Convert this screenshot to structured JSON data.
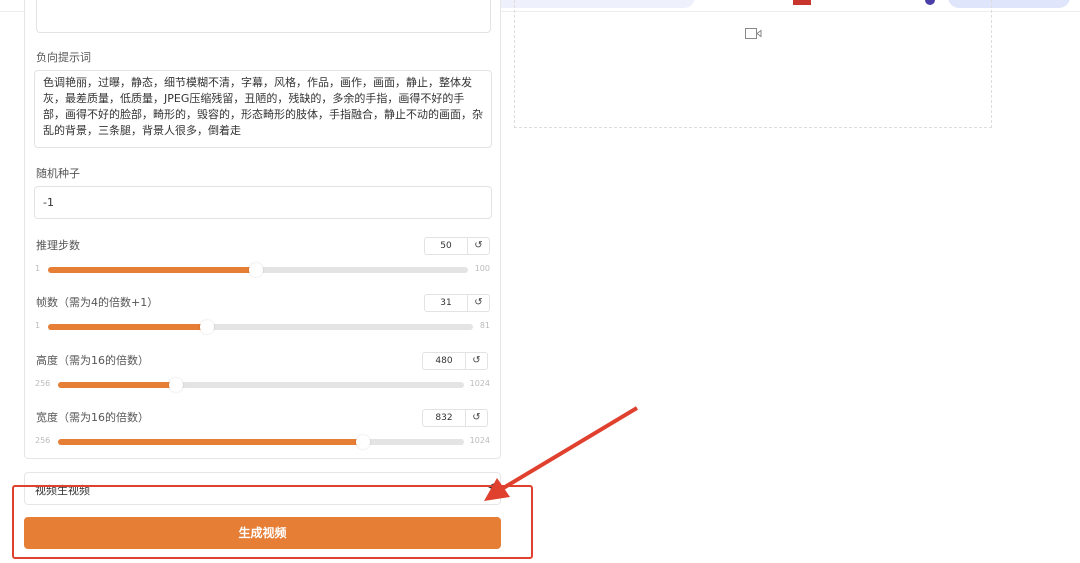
{
  "negative_prompt": {
    "label": "负向提示词",
    "value": "色调艳丽，过曝，静态，细节模糊不清，字幕，风格，作品，画作，画面，静止，整体发灰，最差质量，低质量，JPEG压缩残留，丑陋的，残缺的，多余的手指，画得不好的手部，画得不好的脸部，畸形的，毁容的，形态畸形的肢体，手指融合，静止不动的画面，杂乱的背景，三条腿，背景人很多，倒着走"
  },
  "seed": {
    "label": "随机种子",
    "value": "-1"
  },
  "sliders": [
    {
      "label": "推理步数",
      "value": 50,
      "min": 1,
      "max": 100
    },
    {
      "label": "帧数（需为4的倍数+1）",
      "value": 31,
      "min": 1,
      "max": 81
    },
    {
      "label": "高度（需为16的倍数）",
      "value": 480,
      "min": 256,
      "max": 1024
    },
    {
      "label": "宽度（需为16的倍数）",
      "value": 832,
      "min": 256,
      "max": 1024
    }
  ],
  "accordion": {
    "label": "视频生视频"
  },
  "generate_button": "生成视频",
  "colors": {
    "accent": "#e67e36",
    "annotation": "#e0402e"
  }
}
